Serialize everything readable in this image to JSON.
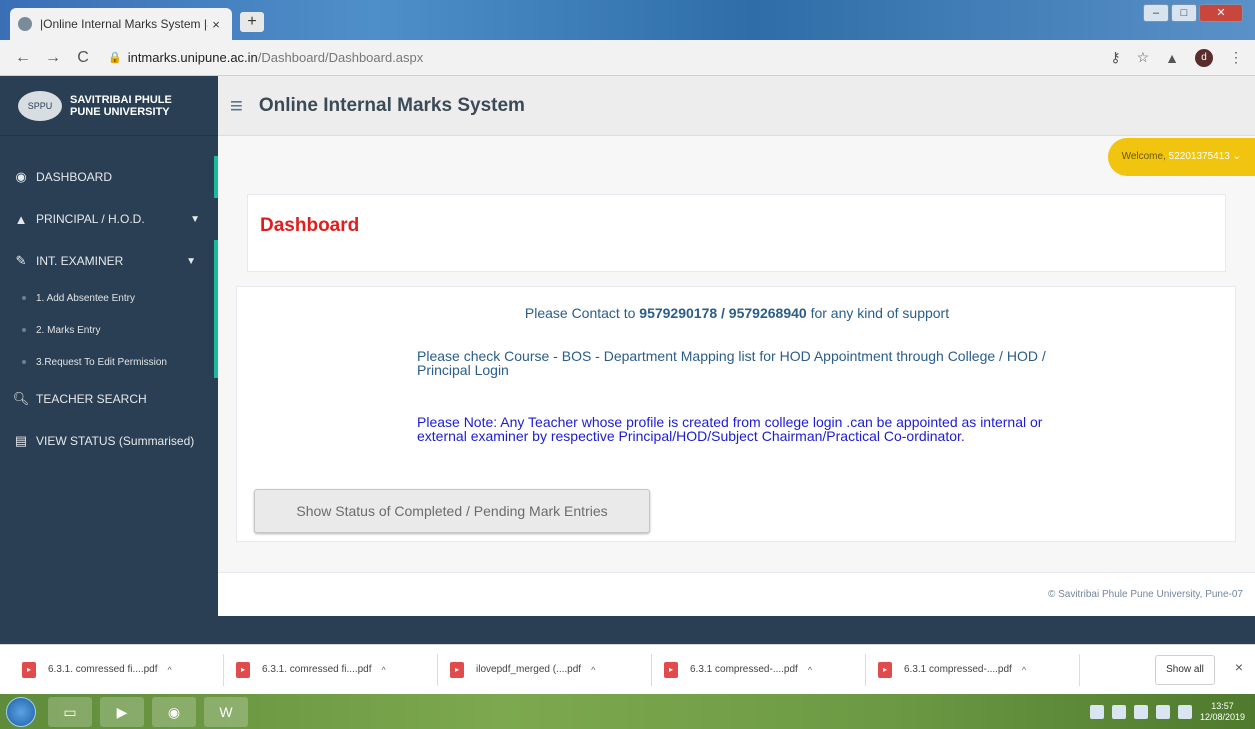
{
  "browser": {
    "tab_title": "|Online Internal Marks System |S",
    "tab_close": "×",
    "new_tab": "+",
    "url_host": "intmarks.unipune.ac.in",
    "url_path": "/Dashboard/Dashboard.aspx"
  },
  "sidebar": {
    "brand_line1": "SAVITRIBAI PHULE",
    "brand_line2": "PUNE UNIVERSITY",
    "items": [
      {
        "label": "DASHBOARD",
        "icon": "dashboard-icon"
      },
      {
        "label": "PRINCIPAL / H.O.D.",
        "icon": "user-icon"
      },
      {
        "label": "INT. EXAMINER",
        "icon": "edit-icon"
      }
    ],
    "sub_items": [
      {
        "label": "1. Add Absentee Entry"
      },
      {
        "label": "2. Marks Entry"
      },
      {
        "label": "3.Request To Edit Permission"
      }
    ],
    "teacher_search": "TEACHER SEARCH",
    "view_status": "VIEW STATUS (Summarised)"
  },
  "header": {
    "title": "Online Internal Marks System",
    "welcome_label": "Welcome,",
    "user_id": "52201375413"
  },
  "main": {
    "dashboard_title": "Dashboard",
    "support_prefix": "Please Contact to",
    "support_phones": "9579290178 / 9579268940",
    "support_suffix": "for any kind of support",
    "mapping_text": "Please check Course - BOS - Department Mapping list for HOD Appointment through College / HOD / Principal Login",
    "note_text": "Please Note: Any Teacher whose profile is created from college login .can be appointed as internal or external examiner by respective Principal/HOD/Subject Chairman/Practical Co-ordinator.",
    "status_button": "Show Status of Completed / Pending Mark Entries",
    "copyright": "© Savitribai Phule Pune University, Pune-07"
  },
  "downloads": {
    "items": [
      {
        "name": "6.3.1. comressed fi....pdf"
      },
      {
        "name": "6.3.1. comressed fi....pdf"
      },
      {
        "name": "ilovepdf_merged (....pdf"
      },
      {
        "name": "6.3.1 compressed-....pdf"
      },
      {
        "name": "6.3.1 compressed-....pdf"
      }
    ],
    "show_all": "Show all",
    "close": "×"
  },
  "taskbar": {
    "time": "13:57",
    "date": "12/08/2019"
  },
  "colors": {
    "sidebar_bg": "#2a3f54",
    "active_accent": "#1abb9c",
    "welcome_bg": "#f1c40f",
    "dashboard_title": "#e01e1e"
  }
}
